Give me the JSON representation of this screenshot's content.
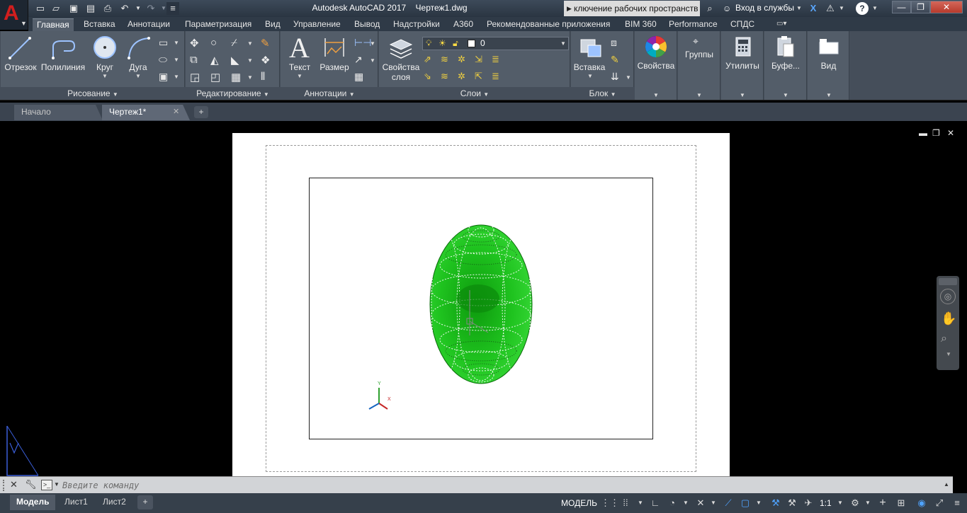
{
  "window": {
    "title": "Autodesk AutoCAD 2017    Чертеж1.dwg",
    "search_text": "ключение рабочих пространств",
    "signin": "Вход в службы",
    "close_label": "✕",
    "minimize_label": "—",
    "restore_label": "❐"
  },
  "ribbon_tabs": [
    "Главная",
    "Вставка",
    "Аннотации",
    "Параметризация",
    "Вид",
    "Управление",
    "Вывод",
    "Надстройки",
    "A360",
    "Рекомендованные приложения",
    "BIM 360",
    "Performance",
    "СПДС"
  ],
  "ribbon": {
    "draw": {
      "line": "Отрезок",
      "polyline": "Полилиния",
      "circle": "Круг",
      "arc": "Дуга",
      "footer": "Рисование"
    },
    "modify": {
      "footer": "Редактирование"
    },
    "annotations": {
      "text": "Текст",
      "dimension": "Размер",
      "footer": "Аннотации"
    },
    "layers": {
      "properties_line1": "Свойства",
      "properties_line2": "слоя",
      "current_layer": "0",
      "footer": "Слои"
    },
    "block": {
      "insert": "Вставка",
      "footer": "Блок"
    },
    "properties": {
      "label": "Свойства"
    },
    "groups": {
      "label": "Группы"
    },
    "utilities": {
      "label": "Утилиты"
    },
    "clipboard": {
      "label": "Буфе..."
    },
    "view": {
      "label": "Вид"
    }
  },
  "file_tabs": {
    "start": "Начало",
    "drawing": "Чертеж1*",
    "close": "✕",
    "plus": "+"
  },
  "viewport_controls": {
    "minimize": "▬",
    "restore": "❐",
    "close": "✕"
  },
  "ucs": {
    "x": "X",
    "y": "Y"
  },
  "command_line": {
    "placeholder": "Введите команду",
    "close": "✕"
  },
  "layout_tabs": [
    "Модель",
    "Лист1",
    "Лист2"
  ],
  "statusbar": {
    "model": "МОДЕЛЬ",
    "scale": "1:1",
    "add": "+"
  },
  "colors": {
    "accent_red": "#d21e1e",
    "ribbon_bg": "#535d69",
    "object_green": "#1ec81e",
    "drawing_bg": "#000000",
    "paper": "#ffffff"
  }
}
